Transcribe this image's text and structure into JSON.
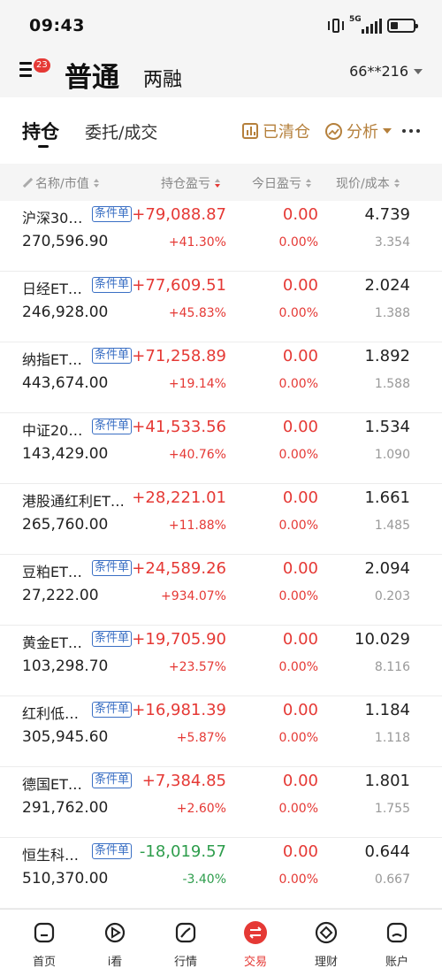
{
  "status": {
    "time": "09:43",
    "network": "5G"
  },
  "header": {
    "menu_badge": "23",
    "tab_normal": "普通",
    "tab_margin": "两融",
    "account": "66**216"
  },
  "subtabs": {
    "holdings": "持仓",
    "orders": "委托/成交",
    "cleared": "已清仓",
    "analysis": "分析"
  },
  "columns": {
    "name": "名称/市值",
    "pnl": "持仓盈亏",
    "today": "今日盈亏",
    "price": "现价/成本"
  },
  "rows": [
    {
      "name": "沪深30…",
      "tag": "条件单",
      "market_value": "270,596.90",
      "pnl": "+79,088.87",
      "pnl_pct": "+41.30%",
      "today": "0.00",
      "today_pct": "0.00%",
      "price": "4.739",
      "cost": "3.354",
      "sign": "pos"
    },
    {
      "name": "日经ET…",
      "tag": "条件单",
      "market_value": "246,928.00",
      "pnl": "+77,609.51",
      "pnl_pct": "+45.83%",
      "today": "0.00",
      "today_pct": "0.00%",
      "price": "2.024",
      "cost": "1.388",
      "sign": "pos"
    },
    {
      "name": "纳指ET…",
      "tag": "条件单",
      "market_value": "443,674.00",
      "pnl": "+71,258.89",
      "pnl_pct": "+19.14%",
      "today": "0.00",
      "today_pct": "0.00%",
      "price": "1.892",
      "cost": "1.588",
      "sign": "pos"
    },
    {
      "name": "中证20…",
      "tag": "条件单",
      "market_value": "143,429.00",
      "pnl": "+41,533.56",
      "pnl_pct": "+40.76%",
      "today": "0.00",
      "today_pct": "0.00%",
      "price": "1.534",
      "cost": "1.090",
      "sign": "pos"
    },
    {
      "name": "港股通红利ET…",
      "tag": "",
      "market_value": "265,760.00",
      "pnl": "+28,221.01",
      "pnl_pct": "+11.88%",
      "today": "0.00",
      "today_pct": "0.00%",
      "price": "1.661",
      "cost": "1.485",
      "sign": "pos"
    },
    {
      "name": "豆粕ET…",
      "tag": "条件单",
      "market_value": "27,222.00",
      "pnl": "+24,589.26",
      "pnl_pct": "+934.07%",
      "today": "0.00",
      "today_pct": "0.00%",
      "price": "2.094",
      "cost": "0.203",
      "sign": "pos"
    },
    {
      "name": "黄金ET…",
      "tag": "条件单",
      "market_value": "103,298.70",
      "pnl": "+19,705.90",
      "pnl_pct": "+23.57%",
      "today": "0.00",
      "today_pct": "0.00%",
      "price": "10.029",
      "cost": "8.116",
      "sign": "pos"
    },
    {
      "name": "红利低…",
      "tag": "条件单",
      "market_value": "305,945.60",
      "pnl": "+16,981.39",
      "pnl_pct": "+5.87%",
      "today": "0.00",
      "today_pct": "0.00%",
      "price": "1.184",
      "cost": "1.118",
      "sign": "pos"
    },
    {
      "name": "德国ET…",
      "tag": "条件单",
      "market_value": "291,762.00",
      "pnl": "+7,384.85",
      "pnl_pct": "+2.60%",
      "today": "0.00",
      "today_pct": "0.00%",
      "price": "1.801",
      "cost": "1.755",
      "sign": "pos"
    },
    {
      "name": "恒生科…",
      "tag": "条件单",
      "market_value": "510,370.00",
      "pnl": "-18,019.57",
      "pnl_pct": "-3.40%",
      "today": "0.00",
      "today_pct": "0.00%",
      "price": "0.644",
      "cost": "0.667",
      "sign": "neg"
    }
  ],
  "nav": [
    {
      "label": "首页",
      "icon": "home-icon",
      "active": false
    },
    {
      "label": "i看",
      "icon": "play-icon",
      "active": false
    },
    {
      "label": "行情",
      "icon": "chart-icon",
      "active": false
    },
    {
      "label": "交易",
      "icon": "trade-icon",
      "active": true
    },
    {
      "label": "理财",
      "icon": "wealth-icon",
      "active": false
    },
    {
      "label": "账户",
      "icon": "account-icon",
      "active": false
    }
  ],
  "colors": {
    "up": "#e53935",
    "down": "#2e9d4c",
    "gold": "#b5803c",
    "tag": "#3a6fc4"
  }
}
